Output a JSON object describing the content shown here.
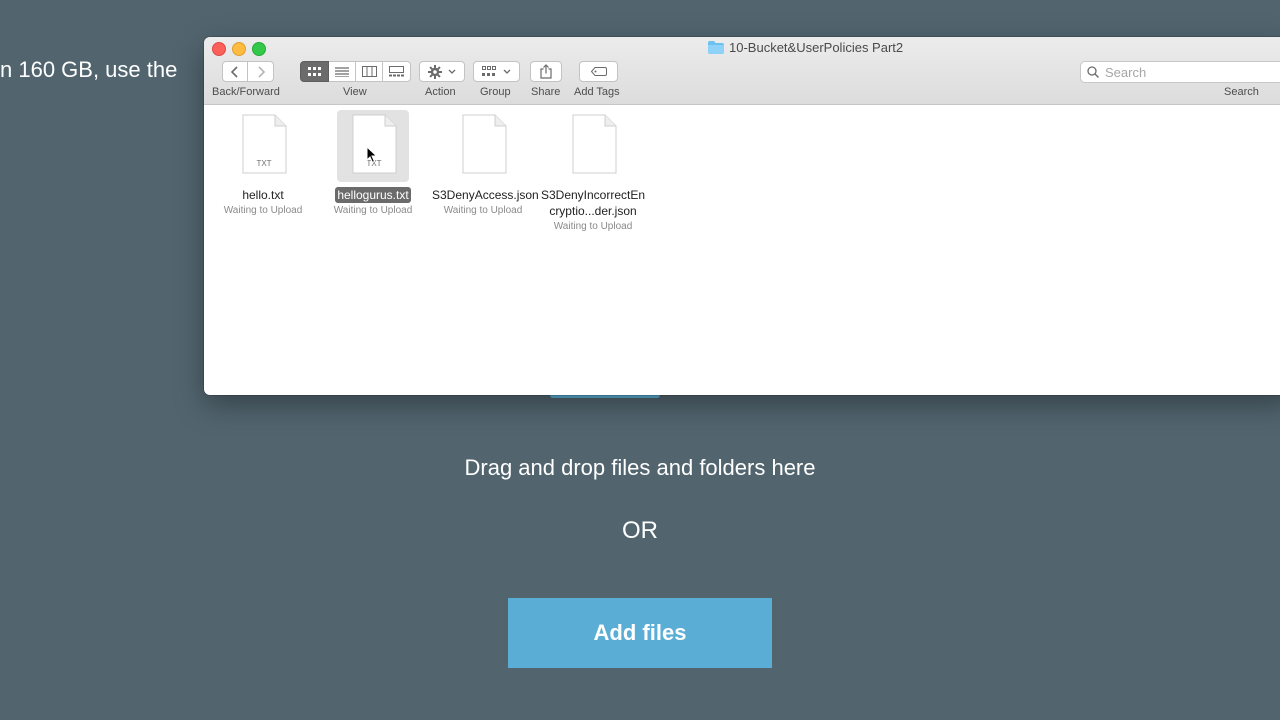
{
  "background": {
    "partial_text": "n 160 GB, use the",
    "drag_text": "Drag and drop files and folders here",
    "or_text": "OR",
    "add_files_label": "Add files"
  },
  "finder": {
    "title": "10-Bucket&UserPolicies Part2",
    "toolbar": {
      "back_forward_label": "Back/Forward",
      "view_label": "View",
      "action_label": "Action",
      "group_label": "Group",
      "share_label": "Share",
      "add_tags_label": "Add Tags",
      "search_label": "Search",
      "search_placeholder": "Search"
    },
    "files": [
      {
        "name": "hello.txt",
        "type": "TXT",
        "status": "Waiting to Upload",
        "selected": false
      },
      {
        "name": "hellogurus.txt",
        "type": "TXT",
        "status": "Waiting to Upload",
        "selected": true
      },
      {
        "name": "S3DenyAccess.json",
        "type": "",
        "status": "Waiting to Upload",
        "selected": false
      },
      {
        "name": "S3DenyIncorrectEncryptio...der.json",
        "type": "",
        "status": "Waiting to Upload",
        "selected": false
      }
    ],
    "icons": [
      "chevron-left-icon",
      "chevron-right-icon",
      "icon-view-icon",
      "list-view-icon",
      "column-view-icon",
      "gallery-view-icon",
      "gear-icon",
      "group-icon",
      "share-icon",
      "tag-icon",
      "search-icon",
      "folder-icon"
    ]
  },
  "colors": {
    "page_bg": "#52656f",
    "accent": "#5aaed6",
    "selection": "#6b6b6b"
  }
}
